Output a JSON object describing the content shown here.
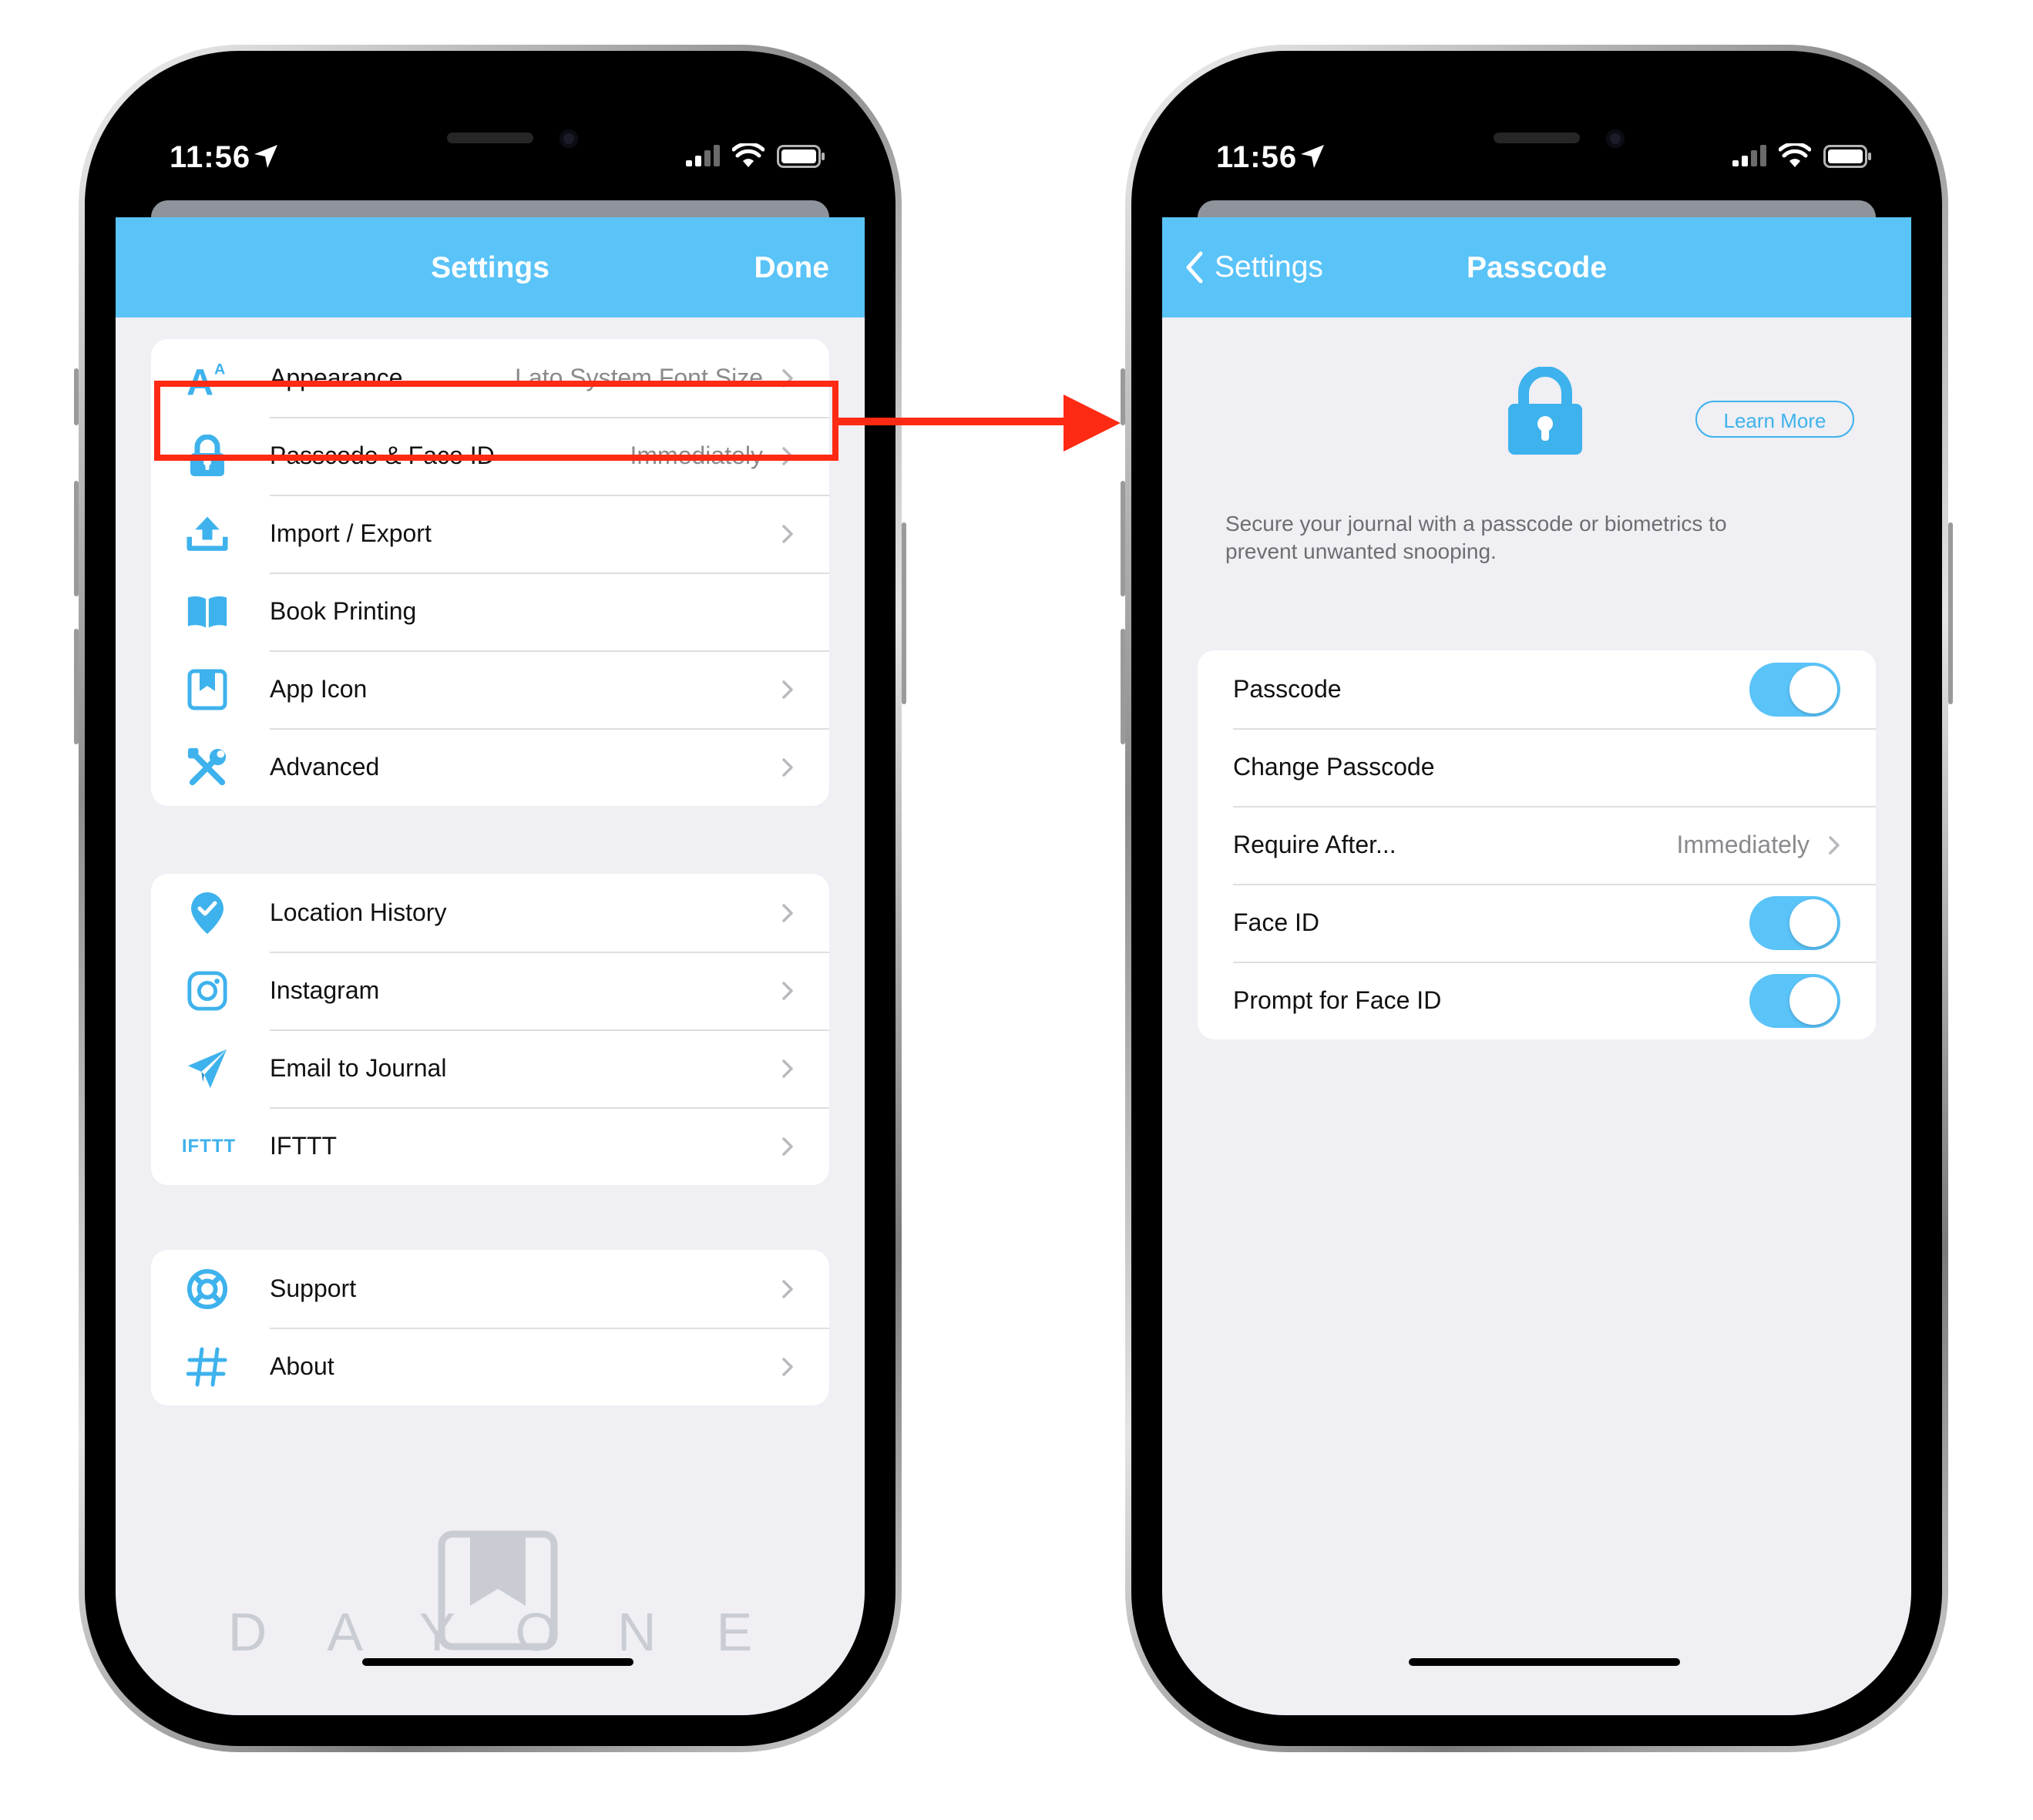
{
  "status_bar": {
    "time": "11:56"
  },
  "left_screen": {
    "nav_title": "Settings",
    "nav_done": "Done",
    "groups": [
      [
        {
          "label": "Appearance",
          "value": "Lato System Font Size",
          "icon": "appearance-icon"
        },
        {
          "label": "Passcode & Face ID",
          "value": "Immediately",
          "icon": "lock-icon"
        },
        {
          "label": "Import / Export",
          "value": "",
          "icon": "upload-icon"
        },
        {
          "label": "Book Printing",
          "value": "",
          "icon": "book-icon"
        },
        {
          "label": "App Icon",
          "value": "",
          "icon": "bookmark-icon"
        },
        {
          "label": "Advanced",
          "value": "",
          "icon": "tools-icon"
        }
      ],
      [
        {
          "label": "Location History",
          "value": "",
          "icon": "location-pin-icon"
        },
        {
          "label": "Instagram",
          "value": "",
          "icon": "instagram-icon"
        },
        {
          "label": "Email to Journal",
          "value": "",
          "icon": "paper-plane-icon"
        },
        {
          "label": "IFTTT",
          "value": "",
          "icon": "ifttt-icon"
        }
      ],
      [
        {
          "label": "Support",
          "value": "",
          "icon": "lifebuoy-icon"
        },
        {
          "label": "About",
          "value": "",
          "icon": "hash-icon"
        }
      ]
    ],
    "ifttt_icon_text": "IFTTT",
    "brand_word": "DAYONE"
  },
  "right_screen": {
    "nav_back": "Settings",
    "nav_title": "Passcode",
    "learn_more": "Learn More",
    "description": "Secure your journal with a passcode or biometrics to prevent unwanted snooping.",
    "rows": [
      {
        "label": "Passcode",
        "value": "",
        "toggle": true,
        "on": true
      },
      {
        "label": "Change Passcode",
        "value": "",
        "toggle": false
      },
      {
        "label": "Require After...",
        "value": "Immediately",
        "toggle": false
      },
      {
        "label": "Face ID",
        "value": "",
        "toggle": true,
        "on": true
      },
      {
        "label": "Prompt for Face ID",
        "value": "",
        "toggle": true,
        "on": true
      }
    ]
  },
  "colors": {
    "accent": "#5ac3f8",
    "icon_blue": "#3eb2ec",
    "highlight_red": "#ff2a13",
    "background": "#efeff4"
  }
}
